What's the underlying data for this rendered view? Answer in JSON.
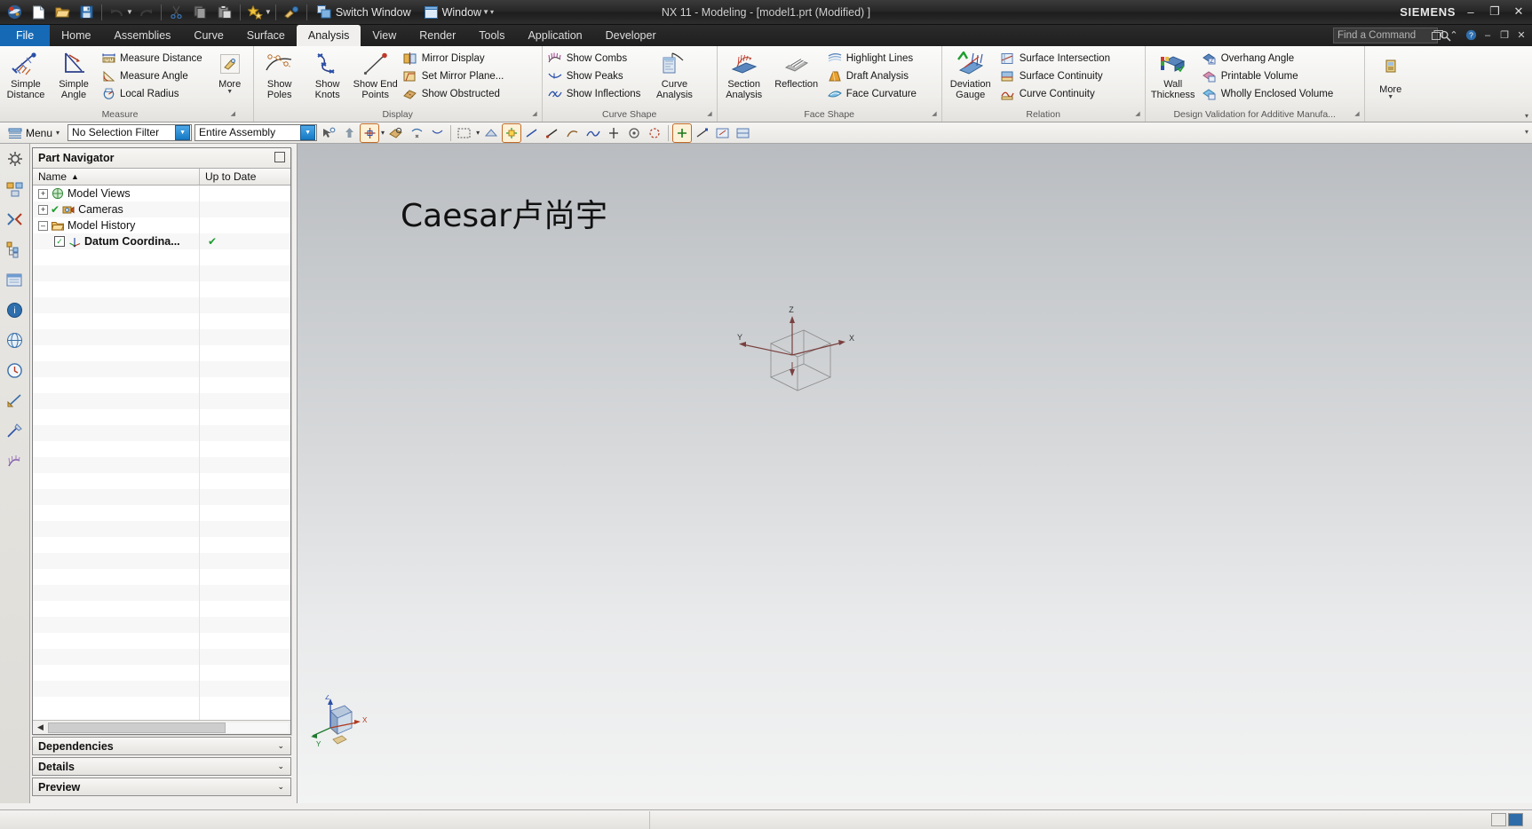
{
  "window": {
    "title": "NX 11 - Modeling - [model1.prt (Modified) ]",
    "brand": "SIEMENS",
    "minimize": "–",
    "maximize": "❐",
    "close": "✕"
  },
  "quick_access": {
    "items": [
      {
        "name": "nx-logo-icon",
        "label": "NX"
      },
      {
        "name": "new-file-icon",
        "label": "New"
      },
      {
        "name": "open-file-icon",
        "label": "Open"
      },
      {
        "name": "save-icon",
        "label": "Save"
      },
      {
        "name": "undo-icon",
        "label": "Undo"
      },
      {
        "name": "redo-icon",
        "label": "Redo"
      },
      {
        "name": "cut-icon",
        "label": "Cut"
      },
      {
        "name": "copy-icon",
        "label": "Copy"
      },
      {
        "name": "paste-icon",
        "label": "Paste"
      },
      {
        "name": "favorites-icon",
        "label": "Favorites"
      },
      {
        "name": "paint-icon",
        "label": "Format Painter"
      }
    ],
    "switch_window": "Switch Window",
    "window_menu": "Window"
  },
  "tabs": [
    {
      "label": "File",
      "active": false,
      "kind": "file"
    },
    {
      "label": "Home",
      "active": false
    },
    {
      "label": "Assemblies",
      "active": false
    },
    {
      "label": "Curve",
      "active": false
    },
    {
      "label": "Surface",
      "active": false
    },
    {
      "label": "Analysis",
      "active": true
    },
    {
      "label": "View",
      "active": false
    },
    {
      "label": "Render",
      "active": false
    },
    {
      "label": "Tools",
      "active": false
    },
    {
      "label": "Application",
      "active": false
    },
    {
      "label": "Developer",
      "active": false
    }
  ],
  "find": {
    "placeholder": "Find a Command",
    "value": "Find a Command"
  },
  "ribbon_right_icons": [
    "search-icon",
    "restore-icon",
    "chevron-up-icon",
    "help-icon",
    "minimize-icon",
    "maximize-icon",
    "close-icon"
  ],
  "ribbon": {
    "groups": [
      {
        "name": "measure",
        "label": "Measure",
        "has_dialog_launcher": true,
        "big": [
          {
            "label": "Simple\nDistance",
            "line1": "Simple",
            "line2": "Distance",
            "icon": "simple-distance-icon"
          },
          {
            "label": "Simple\nAngle",
            "line1": "Simple",
            "line2": "Angle",
            "icon": "simple-angle-icon"
          }
        ],
        "small": [
          {
            "label": "Measure Distance",
            "icon": "measure-distance-icon"
          },
          {
            "label": "Measure Angle",
            "icon": "measure-angle-icon"
          },
          {
            "label": "Local Radius",
            "icon": "local-radius-icon"
          }
        ],
        "more": {
          "label": "More",
          "icon": "more-measure-icon"
        }
      },
      {
        "name": "display",
        "label": "Display",
        "has_dialog_launcher": true,
        "big": [
          {
            "line1": "Show",
            "line2": "Poles",
            "icon": "show-poles-icon"
          },
          {
            "line1": "Show",
            "line2": "Knots",
            "icon": "show-knots-icon"
          },
          {
            "line1": "Show End",
            "line2": "Points",
            "icon": "show-end-points-icon"
          }
        ],
        "small": [
          {
            "label": "Mirror Display",
            "icon": "mirror-display-icon"
          },
          {
            "label": "Set Mirror Plane...",
            "icon": "set-mirror-plane-icon"
          },
          {
            "label": "Show Obstructed",
            "icon": "show-obstructed-icon"
          }
        ]
      },
      {
        "name": "curve-shape",
        "label": "Curve Shape",
        "has_dialog_launcher": true,
        "small": [
          {
            "label": "Show Combs",
            "icon": "show-combs-icon"
          },
          {
            "label": "Show Peaks",
            "icon": "show-peaks-icon"
          },
          {
            "label": "Show Inflections",
            "icon": "show-inflections-icon"
          }
        ],
        "big": [
          {
            "line1": "Curve",
            "line2": "Analysis",
            "icon": "curve-analysis-icon"
          }
        ]
      },
      {
        "name": "face-shape",
        "label": "Face Shape",
        "has_dialog_launcher": true,
        "big": [
          {
            "line1": "Section",
            "line2": "Analysis",
            "icon": "section-analysis-icon"
          },
          {
            "line1": "Reflection",
            "line2": "",
            "icon": "reflection-icon"
          }
        ],
        "small": [
          {
            "label": "Highlight Lines",
            "icon": "highlight-lines-icon"
          },
          {
            "label": "Draft Analysis",
            "icon": "draft-analysis-icon"
          },
          {
            "label": "Face Curvature",
            "icon": "face-curvature-icon"
          }
        ]
      },
      {
        "name": "relation",
        "label": "Relation",
        "has_dialog_launcher": true,
        "big": [
          {
            "line1": "Deviation",
            "line2": "Gauge",
            "icon": "deviation-gauge-icon"
          }
        ],
        "small": [
          {
            "label": "Surface Intersection",
            "icon": "surface-intersection-icon"
          },
          {
            "label": "Surface Continuity",
            "icon": "surface-continuity-icon"
          },
          {
            "label": "Curve Continuity",
            "icon": "curve-continuity-icon"
          }
        ]
      },
      {
        "name": "design-validation",
        "label": "Design Validation for Additive Manufa...",
        "has_dialog_launcher": true,
        "big": [
          {
            "line1": "Wall",
            "line2": "Thickness",
            "icon": "wall-thickness-icon"
          }
        ],
        "small": [
          {
            "label": "Overhang Angle",
            "icon": "overhang-angle-icon"
          },
          {
            "label": "Printable Volume",
            "icon": "printable-volume-icon"
          },
          {
            "label": "Wholly Enclosed Volume",
            "icon": "wholly-enclosed-volume-icon"
          }
        ]
      },
      {
        "name": "more-group",
        "label": "",
        "has_dialog_launcher": false,
        "big": [
          {
            "line1": "More",
            "line2": "",
            "icon": "more-commands-icon"
          }
        ]
      }
    ]
  },
  "selection_toolbar": {
    "menu_label": "Menu",
    "selection_filter": "No Selection Filter",
    "selection_scope": "Entire Assembly",
    "icons": [
      "select-general-objects-icon",
      "up-one-level-icon",
      "snap-point-icon",
      "snap-point-dropdown-icon",
      "face-finder-icon",
      "select-feature-icon",
      "select-body-icon",
      "select-face-icon",
      "select-edge-icon",
      "select-component-icon",
      "highlight-hidden-icon",
      "curve-rule-icon",
      "stop-at-intersection-icon",
      "follow-fillet-icon",
      "tangent-curves-icon",
      "chain-within-features-icon",
      "feature-curves-icon",
      "face-edges-icon",
      "sheet-boundary-icon",
      "region-boundary-icon",
      "infer-curves-icon",
      "single-curve-icon",
      "snap-point-enable-icon",
      "end-point-icon",
      "midpoint-icon",
      "control-point-icon"
    ]
  },
  "resource_bar": {
    "items": [
      {
        "name": "resource-bar-settings-icon",
        "label": "Customize"
      },
      {
        "name": "assembly-navigator-icon",
        "label": "Assembly Navigator"
      },
      {
        "name": "constraint-navigator-icon",
        "label": "Constraint Navigator"
      },
      {
        "name": "part-navigator-icon",
        "label": "Part Navigator"
      },
      {
        "name": "reuse-library-icon",
        "label": "Reuse Library"
      },
      {
        "name": "hd3d-tools-icon",
        "label": "HD3D Tools"
      },
      {
        "name": "web-browser-icon",
        "label": "Web Browser"
      },
      {
        "name": "history-icon",
        "label": "History"
      },
      {
        "name": "process-studio-icon",
        "label": "Process Studio"
      },
      {
        "name": "roles-icon",
        "label": "Roles"
      },
      {
        "name": "system-scene-icon",
        "label": "System Scene"
      }
    ]
  },
  "part_navigator": {
    "title": "Part Navigator",
    "columns": [
      {
        "label": "Name",
        "sort": "▲"
      },
      {
        "label": "Up to Date"
      }
    ],
    "rows": [
      {
        "label": "Model Views",
        "expander": "+",
        "indent": 0,
        "icon": "model-views-icon",
        "check": "",
        "status": ""
      },
      {
        "label": "Cameras",
        "expander": "+",
        "indent": 0,
        "icon": "cameras-icon",
        "check": "✔",
        "status": ""
      },
      {
        "label": "Model History",
        "expander": "–",
        "indent": 0,
        "icon": "folder-icon",
        "check": "",
        "status": ""
      },
      {
        "label": "Datum Coordina...",
        "expander": "",
        "indent": 1,
        "icon": "datum-csys-icon",
        "check": "☑",
        "status": "✔"
      }
    ],
    "sections": [
      {
        "label": "Dependencies",
        "chevron": "⌄"
      },
      {
        "label": "Details",
        "chevron": "⌄"
      },
      {
        "label": "Preview",
        "chevron": "⌄"
      }
    ]
  },
  "graphics": {
    "watermark": "Caesar卢尚宇",
    "wcs_axes": {
      "x": "X",
      "y": "Y",
      "z": "Z"
    },
    "triad_axes": {
      "x": "X",
      "y": "Y",
      "z": "Z"
    }
  },
  "status_bar": {
    "message": "",
    "cells": [
      "status-cell-1",
      "status-cell-2"
    ]
  },
  "colors": {
    "accent_blue": "#1669b5",
    "combo_arrow": "#1579c4",
    "hover_yellow": "#ffe9a8",
    "titlebar_dark": "#272727",
    "ribbon_bg": "#eeedea",
    "check_green": "#1f9d2f"
  }
}
